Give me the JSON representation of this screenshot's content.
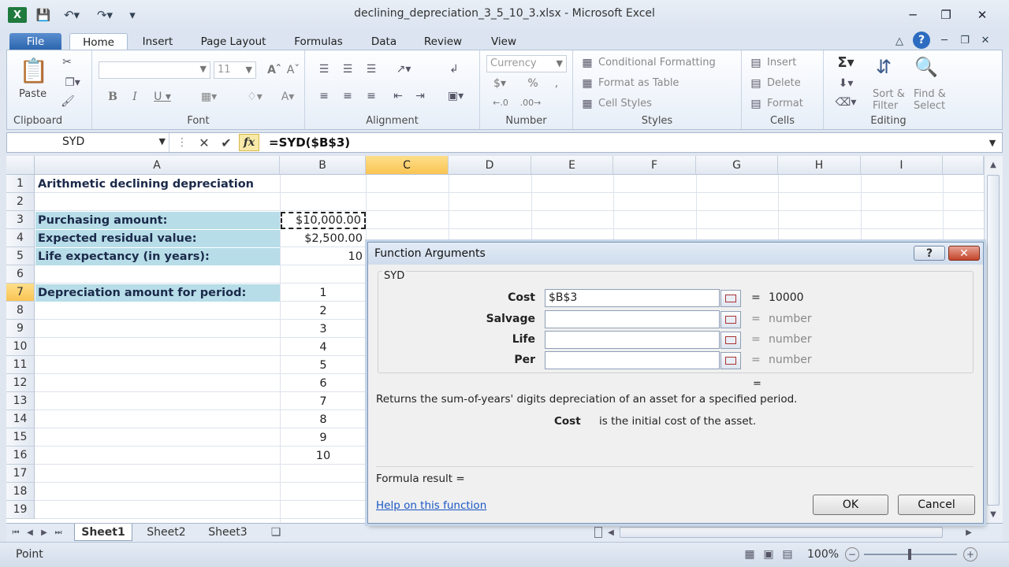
{
  "window": {
    "title": "declining_depreciation_3_5_10_3.xlsx - Microsoft Excel"
  },
  "ribbon_tabs": [
    "File",
    "Home",
    "Insert",
    "Page Layout",
    "Formulas",
    "Data",
    "Review",
    "View"
  ],
  "ribbon": {
    "clipboard": {
      "paste": "Paste",
      "label": "Clipboard"
    },
    "font": {
      "size": "11",
      "label": "Font"
    },
    "alignment": {
      "label": "Alignment"
    },
    "number": {
      "format": "Currency",
      "currency_symbol": "$",
      "percent": "%",
      "comma": ",",
      "label": "Number"
    },
    "styles": {
      "conditional": "Conditional Formatting",
      "format_table": "Format as Table",
      "cell_styles": "Cell Styles",
      "label": "Styles"
    },
    "cells": {
      "insert": "Insert",
      "delete": "Delete",
      "format": "Format",
      "label": "Cells"
    },
    "editing": {
      "sort": "Sort &",
      "filter": "Filter",
      "find": "Find &",
      "select": "Select",
      "label": "Editing"
    }
  },
  "formula_bar": {
    "name_box": "SYD",
    "fx": "fx",
    "formula": "=SYD($B$3)"
  },
  "columns": [
    "A",
    "B",
    "C",
    "D",
    "E",
    "F",
    "G",
    "H",
    "I"
  ],
  "rows": [
    "1",
    "2",
    "3",
    "4",
    "5",
    "6",
    "7",
    "8",
    "9",
    "10",
    "11",
    "12",
    "13",
    "14",
    "15",
    "16",
    "17",
    "18",
    "19"
  ],
  "cells": {
    "a1": "Arithmetic declining depreciation",
    "a3": "Purchasing amount:",
    "a4": "Expected residual value:",
    "a5": "Life expectancy (in years):",
    "a7": "Depreciation amount for period:",
    "b3": "$10,000.00",
    "b4": "$2,500.00",
    "b5": "10",
    "periods": [
      "1",
      "2",
      "3",
      "4",
      "5",
      "6",
      "7",
      "8",
      "9",
      "10"
    ]
  },
  "dialog": {
    "title": "Function Arguments",
    "help_icon": "?",
    "function_name": "SYD",
    "args": [
      {
        "label": "Cost",
        "value": "$B$3",
        "result": "10000"
      },
      {
        "label": "Salvage",
        "value": "",
        "result": "number"
      },
      {
        "label": "Life",
        "value": "",
        "result": "number"
      },
      {
        "label": "Per",
        "value": "",
        "result": "number"
      }
    ],
    "equals": "=",
    "description": "Returns the sum-of-years' digits depreciation of an asset for a specified period.",
    "arg_help_name": "Cost",
    "arg_help_text": "is the initial cost of the asset.",
    "formula_result": "Formula result =",
    "help_link": "Help on this function",
    "ok": "OK",
    "cancel": "Cancel"
  },
  "sheets": [
    "Sheet1",
    "Sheet2",
    "Sheet3"
  ],
  "status": {
    "mode": "Point",
    "zoom": "100%"
  },
  "colors": {
    "accent": "#2a64ad",
    "label_fill": "#b7dde8",
    "selected_header": "#f9c453"
  }
}
